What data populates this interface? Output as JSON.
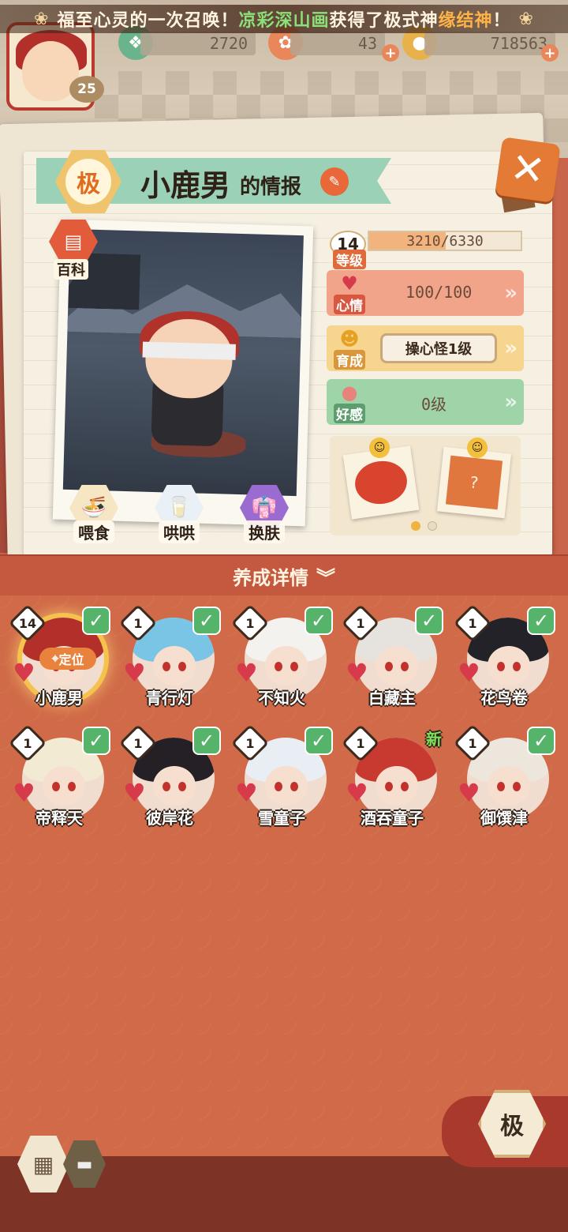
{
  "banner": {
    "prefix": "福至心灵的一次召唤！",
    "player": "凉彩深山画",
    "middle": "获得了极式神",
    "shikigami": "缘结神",
    "suffix": "！"
  },
  "hud": {
    "player_level": "25",
    "resources": [
      {
        "value": "2720",
        "icon": "jade-icon"
      },
      {
        "value": "43",
        "icon": "fish-icon"
      },
      {
        "value": "718563",
        "icon": "coin-icon"
      }
    ]
  },
  "info": {
    "grade": "极",
    "name": "小鹿男",
    "title_suffix": "的情报",
    "wiki_label": "百科",
    "actions": [
      "喂食",
      "哄哄",
      "换肤"
    ],
    "stats": {
      "level": {
        "label": "等级",
        "value": "14",
        "exp": "3210/6330",
        "exp_fraction": 0.507
      },
      "mood": {
        "label": "心情",
        "value": "100/100"
      },
      "growth": {
        "label": "育成",
        "chip": "操心怪1级"
      },
      "affinity": {
        "label": "好感",
        "value": "0级"
      }
    },
    "dish_card": {
      "page_count": 2,
      "active_page": 0
    }
  },
  "nurture": {
    "title": "养成详情"
  },
  "roster": {
    "locate_label": "定位",
    "new_label": "新",
    "cards": [
      {
        "name": "小鹿男",
        "level": "14",
        "checked": true,
        "selected": true,
        "new": false,
        "hair": "#b3302a"
      },
      {
        "name": "青行灯",
        "level": "1",
        "checked": true,
        "selected": false,
        "new": false,
        "hair": "#7ac4e6"
      },
      {
        "name": "不知火",
        "level": "1",
        "checked": true,
        "selected": false,
        "new": false,
        "hair": "#f4f2ee"
      },
      {
        "name": "白藏主",
        "level": "1",
        "checked": true,
        "selected": false,
        "new": false,
        "hair": "#e6e3df"
      },
      {
        "name": "花鸟卷",
        "level": "1",
        "checked": true,
        "selected": false,
        "new": false,
        "hair": "#222228"
      },
      {
        "name": "帝释天",
        "level": "1",
        "checked": true,
        "selected": false,
        "new": false,
        "hair": "#f2ead2"
      },
      {
        "name": "彼岸花",
        "level": "1",
        "checked": true,
        "selected": false,
        "new": false,
        "hair": "#242026"
      },
      {
        "name": "雪童子",
        "level": "1",
        "checked": true,
        "selected": false,
        "new": false,
        "hair": "#e9eef4"
      },
      {
        "name": "酒吞童子",
        "level": "1",
        "checked": false,
        "selected": false,
        "new": true,
        "hair": "#c83a30"
      },
      {
        "name": "御馔津",
        "level": "1",
        "checked": true,
        "selected": false,
        "new": false,
        "hair": "#ece6dc"
      }
    ]
  },
  "bottom": {
    "grade_filter": "极"
  },
  "colors": {
    "accent": "#e37a35",
    "roster_bg": "#d06a48",
    "check": "#56b46a",
    "mood": "#f2a48a",
    "growth": "#f6d58f",
    "affinity": "#9fd4a8"
  }
}
